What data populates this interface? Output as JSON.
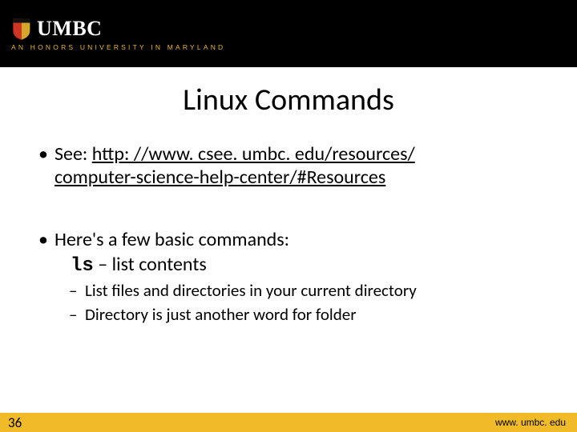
{
  "header": {
    "logo_text": "UMBC",
    "tagline": "AN HONORS UNIVERSITY IN MARYLAND"
  },
  "title": "Linux Commands",
  "bullets": {
    "see_label": "See: ",
    "link_line1": "http: //www. csee. umbc. edu/resources/",
    "link_line2": "computer-science-help-center/#Resources",
    "intro": "Here's a few basic commands:",
    "cmd": "ls",
    "cmd_desc": " – list contents",
    "sub1": "List files and directories in your current directory",
    "sub2": "Directory is just another word for folder"
  },
  "footer": {
    "page": "36",
    "url": "www. umbc. edu"
  }
}
